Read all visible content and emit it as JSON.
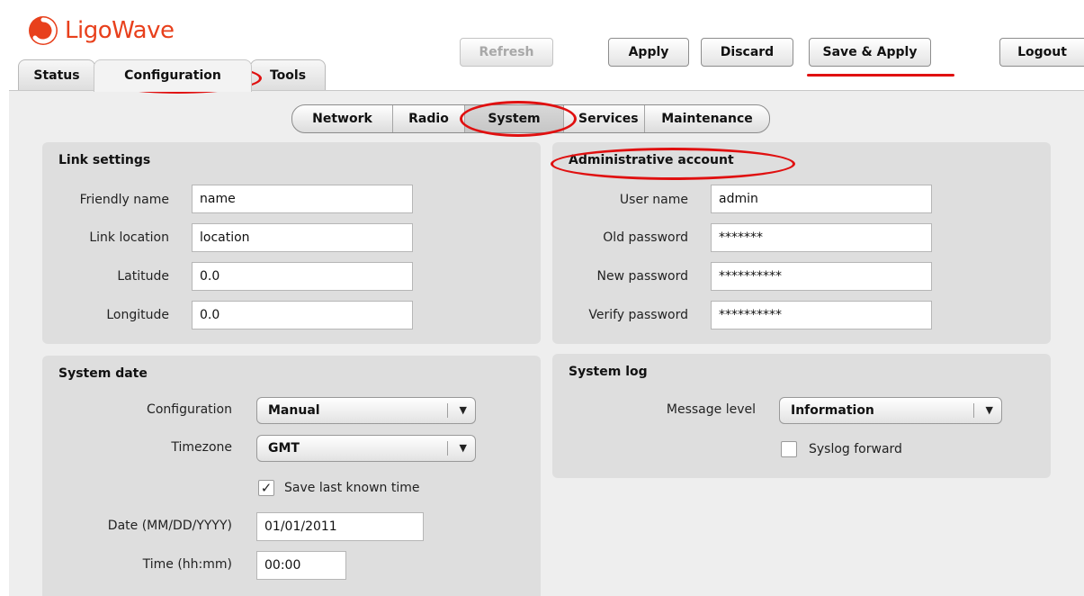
{
  "app": {
    "brand_main": "Ligo",
    "brand_accent": "Wave",
    "brand_color": "#e8401c"
  },
  "tabs": [
    {
      "label": "Status"
    },
    {
      "label": "Configuration"
    },
    {
      "label": "Tools"
    }
  ],
  "toolbar": {
    "refresh_label": "Refresh",
    "apply_label": "Apply",
    "discard_label": "Discard",
    "save_apply_label": "Save & Apply",
    "logout_label": "Logout"
  },
  "subnav": [
    {
      "label": "Network"
    },
    {
      "label": "Radio"
    },
    {
      "label": "System"
    },
    {
      "label": "Services"
    },
    {
      "label": "Maintenance"
    }
  ],
  "link_settings": {
    "title": "Link settings",
    "friendly_name_label": "Friendly name",
    "friendly_name_value": "name",
    "link_location_label": "Link location",
    "link_location_value": "location",
    "latitude_label": "Latitude",
    "latitude_value": "0.0",
    "longitude_label": "Longitude",
    "longitude_value": "0.0"
  },
  "admin_account": {
    "title": "Administrative account",
    "user_name_label": "User name",
    "user_name_value": "admin",
    "old_password_label": "Old password",
    "old_password_value": "*******",
    "new_password_label": "New password",
    "new_password_value": "**********",
    "verify_password_label": "Verify password",
    "verify_password_value": "**********"
  },
  "system_date": {
    "title": "System date",
    "configuration_label": "Configuration",
    "configuration_value": "Manual",
    "timezone_label": "Timezone",
    "timezone_value": "GMT",
    "save_last_known_label": "Save last known time",
    "save_last_known_checked": true,
    "date_label": "Date (MM/DD/YYYY)",
    "date_value": "01/01/2011",
    "time_label": "Time (hh:mm)",
    "time_value": "00:00"
  },
  "system_log": {
    "title": "System log",
    "message_level_label": "Message level",
    "message_level_value": "Information",
    "syslog_forward_label": "Syslog forward",
    "syslog_forward_checked": false
  },
  "icons": {
    "dropdown_arrow": "▼",
    "check_mark": "✓"
  }
}
